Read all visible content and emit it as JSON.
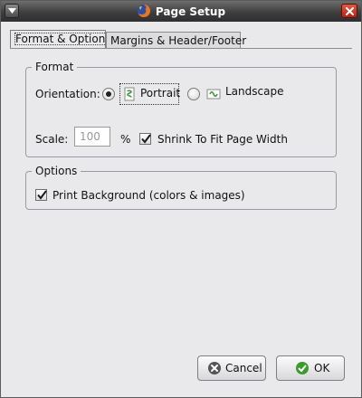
{
  "window": {
    "title": "Page Setup"
  },
  "tabs": [
    {
      "label": "Format & Options",
      "active": true
    },
    {
      "label": "Margins & Header/Footer",
      "active": false
    }
  ],
  "format": {
    "legend": "Format",
    "orientation_label": "Orientation:",
    "portrait_label": "Portrait",
    "landscape_label": "Landscape",
    "selected_orientation": "Portrait",
    "scale_label": "Scale:",
    "scale_value": "100",
    "percent_sign": "%",
    "shrink_label": "Shrink To Fit Page Width",
    "shrink_checked": true
  },
  "options": {
    "legend": "Options",
    "print_bg_label": "Print Background (colors & images)",
    "print_bg_checked": true
  },
  "buttons": {
    "cancel_label": "Cancel",
    "ok_label": "OK"
  },
  "colors": {
    "cancel_icon": "#555555",
    "ok_icon": "#3c9a2e"
  }
}
